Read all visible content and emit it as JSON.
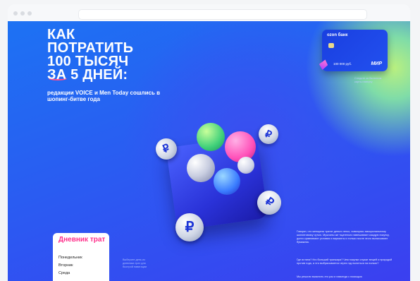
{
  "headline": {
    "lines": [
      "КАК",
      "ПОТРАТИТЬ",
      "100 ТЫСЯЧ",
      "ЗА 5 ДНЕЙ:"
    ],
    "subtitle": "редакции VOICE и Men Today сошлись в шопинг-битве года"
  },
  "card": {
    "bank": "ozon банк",
    "amount": "100 000 руб.",
    "brand": "МИР",
    "note": "Следите за балансом карты наверху"
  },
  "diary": {
    "title": "Дневник трат",
    "items": [
      "Понедельник",
      "Вторник",
      "Среда"
    ]
  },
  "side_note": "Выберите день из дневника трат для быстрой навигации",
  "body": {
    "p1": "Говорят, что женщины тратят деньги легко, повинуясь эмоциональному шопинговому чутью. Мужчины же тщательно взвешивают каждую покупку, долго сравнивают условия и варианты и только после этого выписывают бумажник.",
    "p2": "Где истина? Кто больший транжира? Чем покупки служат вещей и природой против года, а что выбрасывается через год пылиться на полках?",
    "p3": "Мы решили выяснить это раз и навсегда с помощью"
  },
  "colors": {
    "accent_pink": "#ff2e8a",
    "bg_blue": "#2a5cf2",
    "card_blue": "#1a3fe0"
  },
  "icons": [
    "ruble-coin-icon",
    "gem-icon",
    "chip-icon"
  ]
}
